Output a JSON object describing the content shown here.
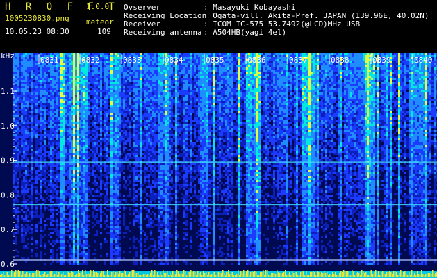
{
  "header": {
    "app_name": "H R O F F T",
    "version": "1.0.0",
    "filename": "1005230830.png",
    "mode": "meteor",
    "datetime": "10.05.23 08:30",
    "count": "109",
    "info": [
      {
        "key": "Ovserver",
        "value": ": Masayuki Kobayashi"
      },
      {
        "key": "Receiving Location",
        "value": ": Ogata-vill. Akita-Pref. JAPAN (139.96E, 40.02N)"
      },
      {
        "key": "Receiver",
        "value": ": ICOM IC-575 53.7492(@LCD)MHz USB"
      },
      {
        "key": "Receiving antenna",
        "value": ": A504HB(yagi 4el)"
      }
    ]
  },
  "chart_data": {
    "type": "heatmap",
    "y_unit": "kHz",
    "y_ticks": [
      "1.1",
      "1.0",
      "0.9",
      "0.8",
      "0.7",
      "0.6"
    ],
    "x_ticks": [
      "0831",
      "0832",
      "0833",
      "0834",
      "0835",
      "0836",
      "0837",
      "0838",
      "0839",
      "0840"
    ],
    "ylim": [
      0.58,
      1.18
    ],
    "xlim": [
      "08:30",
      "08:40"
    ],
    "colors": {
      "low": "#000a5a",
      "mid": "#1b3cff",
      "high": "#00e6e6",
      "peak": "#e8e83a"
    }
  }
}
